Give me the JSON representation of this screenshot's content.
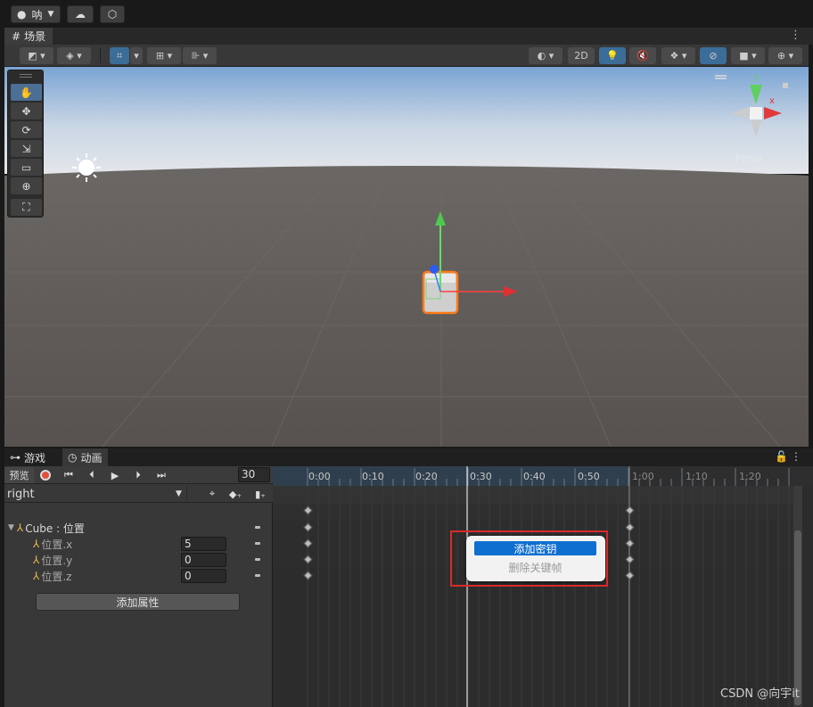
{
  "topbar": {
    "account_label": "呐",
    "account_icon": "user-circle-icon",
    "cloud_icon": "cloud-icon",
    "collab_icon": "collab-icon"
  },
  "scene": {
    "tab_label": "场景",
    "tab_icon": "grid-hash-icon",
    "toolbar": {
      "mode_2d": "2D"
    },
    "gizmo_label": "Persp"
  },
  "tools": [
    {
      "name": "hand-tool",
      "icon": "✋",
      "active": true
    },
    {
      "name": "move-tool",
      "icon": "✥",
      "active": false
    },
    {
      "name": "rotate-tool",
      "icon": "⟳",
      "active": false
    },
    {
      "name": "scale-tool",
      "icon": "⇲",
      "active": false
    },
    {
      "name": "rect-tool",
      "icon": "▭",
      "active": false
    },
    {
      "name": "transform-tool",
      "icon": "⊕",
      "active": false
    },
    {
      "name": "custom-tool",
      "icon": "⛶",
      "active": false
    }
  ],
  "animation": {
    "tabs": [
      {
        "label": "游戏",
        "icon": "gamepad-icon",
        "active": false
      },
      {
        "label": "动画",
        "icon": "clock-icon",
        "active": true
      }
    ],
    "preview_label": "预览",
    "frame": "30",
    "clip": "right",
    "property_group": "Cube : 位置",
    "properties": [
      {
        "label": "位置.x",
        "value": "5"
      },
      {
        "label": "位置.y",
        "value": "0"
      },
      {
        "label": "位置.z",
        "value": "0"
      }
    ],
    "add_property": "添加属性",
    "ruler": [
      "0:00",
      "0:10",
      "0:20",
      "0:30",
      "0:40",
      "0:50",
      "1:00",
      "1:10",
      "1:20"
    ],
    "playhead_time": "0:30"
  },
  "context_menu": {
    "items": [
      {
        "label": "添加密钥",
        "state": "selected"
      },
      {
        "label": "删除关键帧",
        "state": "disabled"
      }
    ]
  },
  "watermark": "CSDN @向宇it"
}
